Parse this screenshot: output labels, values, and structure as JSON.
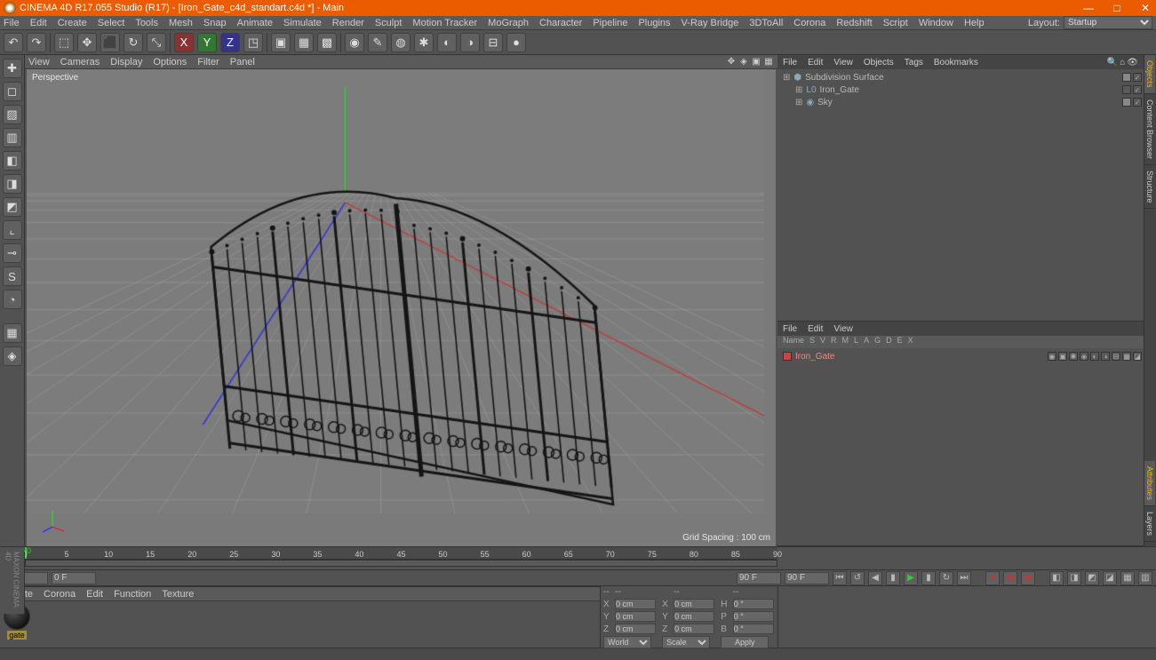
{
  "window": {
    "title": "CINEMA 4D R17.055 Studio (R17) - [Iron_Gate_c4d_standart.c4d *] - Main",
    "minimize": "—",
    "maximize": "□",
    "close": "✕"
  },
  "main_menu": [
    "File",
    "Edit",
    "Create",
    "Select",
    "Tools",
    "Mesh",
    "Snap",
    "Animate",
    "Simulate",
    "Render",
    "Sculpt",
    "Motion Tracker",
    "MoGraph",
    "Character",
    "Pipeline",
    "Plugins",
    "V-Ray Bridge",
    "3DToAll",
    "Corona",
    "Redshift",
    "Script",
    "Window",
    "Help"
  ],
  "layout_label": "Layout:",
  "layout_value": "Startup",
  "toolbar_icons": [
    "↶",
    "↷",
    "|",
    "⬚",
    "✥",
    "⬛",
    "↻",
    "⤡",
    "|",
    "X",
    "Y",
    "Z",
    "◳",
    "|",
    "▣",
    "▦",
    "▩",
    "|",
    "◉",
    "✎",
    "◍",
    "✱",
    "◐",
    "◑",
    "⊟",
    "●"
  ],
  "left_tool_icons": [
    "✚",
    "◻",
    "▨",
    "▥",
    "◧",
    "◨",
    "◩",
    "⌞",
    "⊸",
    "S",
    "◔",
    "|",
    "▦",
    "◈"
  ],
  "viewport_menus": [
    "View",
    "Cameras",
    "Display",
    "Options",
    "Filter",
    "Panel"
  ],
  "viewport": {
    "label": "Perspective",
    "grid_info": "Grid Spacing : 100 cm"
  },
  "right_vtabs": [
    "Objects",
    "Content Browser",
    "Structure"
  ],
  "right_vtabs2": [
    "Attributes",
    "Layers"
  ],
  "object_mgr": {
    "menus": [
      "File",
      "Edit",
      "View",
      "Objects",
      "Tags",
      "Bookmarks"
    ],
    "tree": [
      {
        "name": "Subdivision Surface",
        "indent": 0,
        "icon": "⬢",
        "swatch": "grey"
      },
      {
        "name": "Iron_Gate",
        "indent": 1,
        "icon": "L0",
        "swatch": "red"
      },
      {
        "name": "Sky",
        "indent": 1,
        "icon": "◉",
        "swatch": "grey"
      }
    ]
  },
  "attr_mgr": {
    "menus": [
      "File",
      "Edit",
      "View"
    ],
    "headers": [
      "Name",
      "S",
      "V",
      "R",
      "M",
      "L",
      "A",
      "G",
      "D",
      "E",
      "X"
    ],
    "rows": [
      {
        "name": "Iron_Gate"
      }
    ]
  },
  "timeline": {
    "ticks": [
      0,
      5,
      10,
      15,
      20,
      25,
      30,
      35,
      40,
      45,
      50,
      55,
      60,
      65,
      70,
      75,
      80,
      85,
      90
    ],
    "start": "0 F",
    "end": "90 F",
    "play_start": "0 F",
    "play_end": "90 F"
  },
  "playback_icons": [
    "⏮",
    "↺",
    "◀",
    "▮",
    "▶",
    "▮",
    "↻",
    "⏭"
  ],
  "rec_icons": [
    "●",
    "◉",
    "◉"
  ],
  "filter_icons": [
    "◧",
    "◨",
    "◩",
    "◪",
    "▦",
    "▥"
  ],
  "material_mgr": {
    "menus": [
      "Create",
      "Corona",
      "Edit",
      "Function",
      "Texture"
    ],
    "materials": [
      {
        "name": "gate"
      }
    ]
  },
  "coords": {
    "rows": [
      {
        "axis": "X",
        "p": "0 cm",
        "s": "X",
        "sv": "0 cm",
        "r": "H",
        "rv": "0 °"
      },
      {
        "axis": "Y",
        "p": "0 cm",
        "s": "Y",
        "sv": "0 cm",
        "r": "P",
        "rv": "0 °"
      },
      {
        "axis": "Z",
        "p": "0 cm",
        "s": "Z",
        "sv": "0 cm",
        "r": "B",
        "rv": "0 °"
      }
    ],
    "mode1": "World",
    "mode2": "Scale",
    "apply": "Apply"
  },
  "logo": "MAXON CINEMA 4D"
}
